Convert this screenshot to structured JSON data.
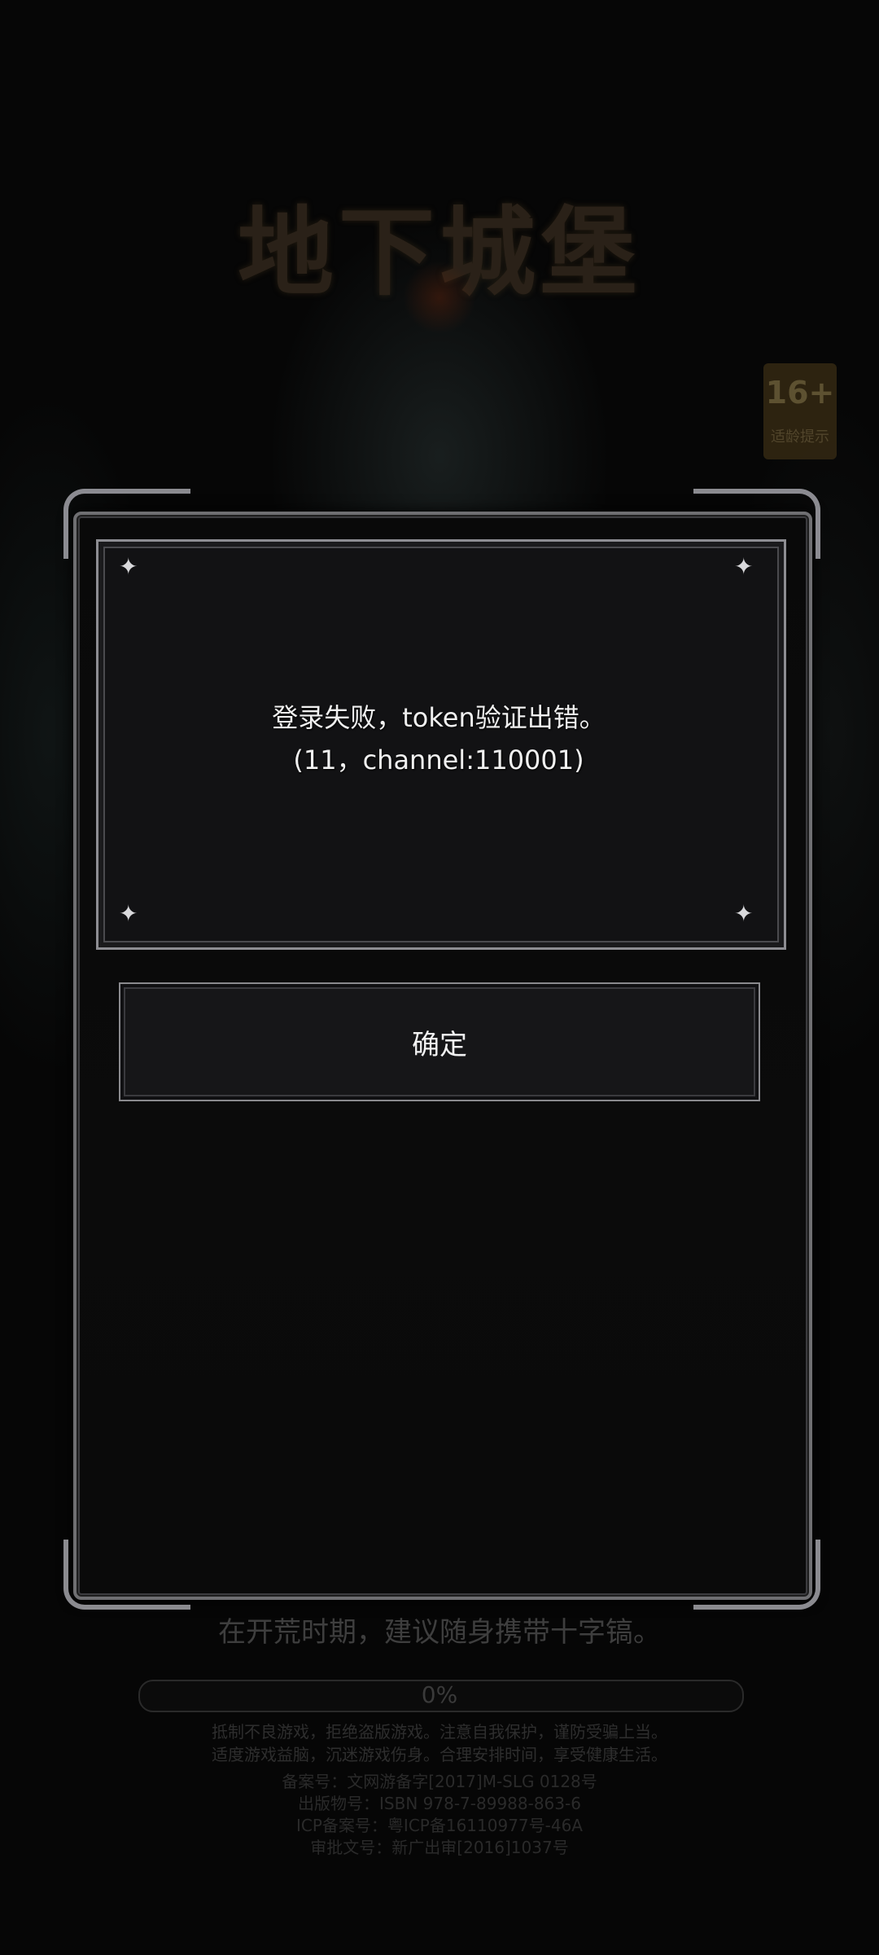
{
  "game": {
    "logo_text": "地下城堡",
    "age_rating": "16+",
    "age_rating_label": "适龄提示"
  },
  "dialog": {
    "message_line1": "登录失败，token验证出错。",
    "message_line2": "(11，channel:110001)",
    "confirm_label": "确定"
  },
  "loading": {
    "tip": "在开荒时期，建议随身携带十字镐。",
    "progress_text": "0%",
    "progress_value": 0
  },
  "health_notice": [
    "抵制不良游戏，拒绝盗版游戏。注意自我保护，谨防受骗上当。",
    "适度游戏益脑，沉迷游戏伤身。合理安排时间，享受健康生活。"
  ],
  "license_info": [
    "备案号：文网游备字[2017]M-SLG 0128号",
    "出版物号：ISBN 978-7-89988-863-6",
    "ICP备案号：粤ICP备16110977号-46A",
    "审批文号：新广出审[2016]1037号"
  ]
}
